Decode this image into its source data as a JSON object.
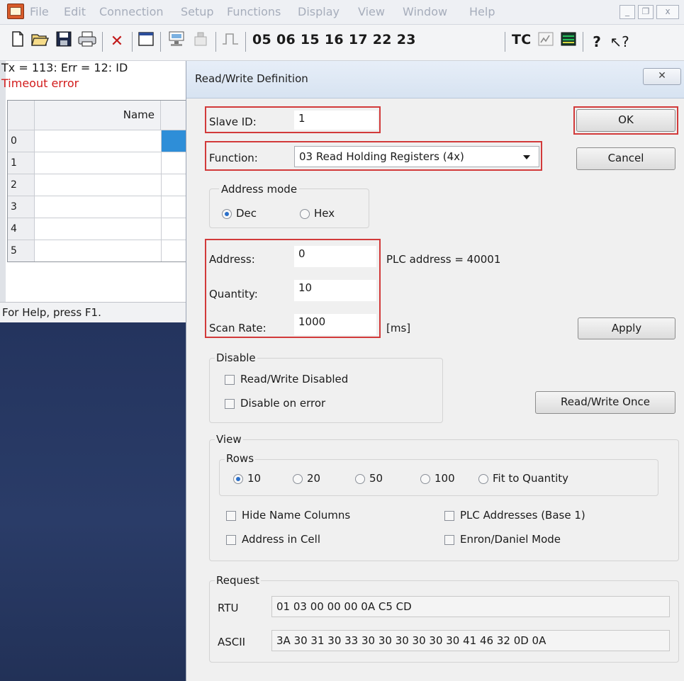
{
  "menubar": {
    "items": [
      "File",
      "Edit",
      "Connection",
      "Setup",
      "Functions",
      "Display",
      "View",
      "Window",
      "Help"
    ],
    "window_buttons": [
      "_",
      "̅",
      "x"
    ]
  },
  "toolbar": {
    "function_codes": "05 06 15 16 17 22 23",
    "tc_label": "TC",
    "icons": [
      "new-icon",
      "open-icon",
      "save-icon",
      "print-icon",
      "delete-icon",
      "window-icon",
      "connect-icon",
      "disconnect-icon",
      "pulse-icon",
      "trace-icon",
      "chart-icon",
      "help-icon",
      "context-help-icon"
    ]
  },
  "status": {
    "line1": "Tx = 113: Err = 12: ID",
    "line2": "Timeout error"
  },
  "grid": {
    "header_name": "Name",
    "rows": [
      "0",
      "1",
      "2",
      "3",
      "4",
      "5"
    ]
  },
  "helpbar": "For Help, press F1.",
  "dialog": {
    "title": "Read/Write Definition",
    "close": "✕",
    "slave_id_label": "Slave ID:",
    "slave_id_value": "1",
    "function_label": "Function:",
    "function_value": "03 Read Holding Registers (4x)",
    "ok": "OK",
    "cancel": "Cancel",
    "address_mode": {
      "title": "Address mode",
      "dec": "Dec",
      "hex": "Hex",
      "selected": "Dec"
    },
    "address_label": "Address:",
    "address_value": "0",
    "plc_address": "PLC address = 40001",
    "quantity_label": "Quantity:",
    "quantity_value": "10",
    "scan_rate_label": "Scan Rate:",
    "scan_rate_value": "1000",
    "scan_rate_unit": "[ms]",
    "apply": "Apply",
    "disable": {
      "title": "Disable",
      "rw_disabled": "Read/Write Disabled",
      "disable_on_error": "Disable on error"
    },
    "read_write_once": "Read/Write Once",
    "view": {
      "title": "View",
      "rows_title": "Rows",
      "rows_options": [
        "10",
        "20",
        "50",
        "100",
        "Fit to Quantity"
      ],
      "rows_selected": "10",
      "hide_name_columns": "Hide Name Columns",
      "plc_addresses": "PLC Addresses (Base 1)",
      "address_in_cell": "Address in Cell",
      "enron_daniel": "Enron/Daniel Mode"
    },
    "request": {
      "title": "Request",
      "rtu_label": "RTU",
      "rtu_value": "01 03 00 00 00 0A C5 CD",
      "ascii_label": "ASCII",
      "ascii_value": "3A 30 31 30 33 30 30 30 30 30 30 41 46 32 0D 0A"
    }
  },
  "colors": {
    "highlight_red": "#d23a3a",
    "selection_blue": "#2e8ed8",
    "error_red": "#d21b1b"
  }
}
